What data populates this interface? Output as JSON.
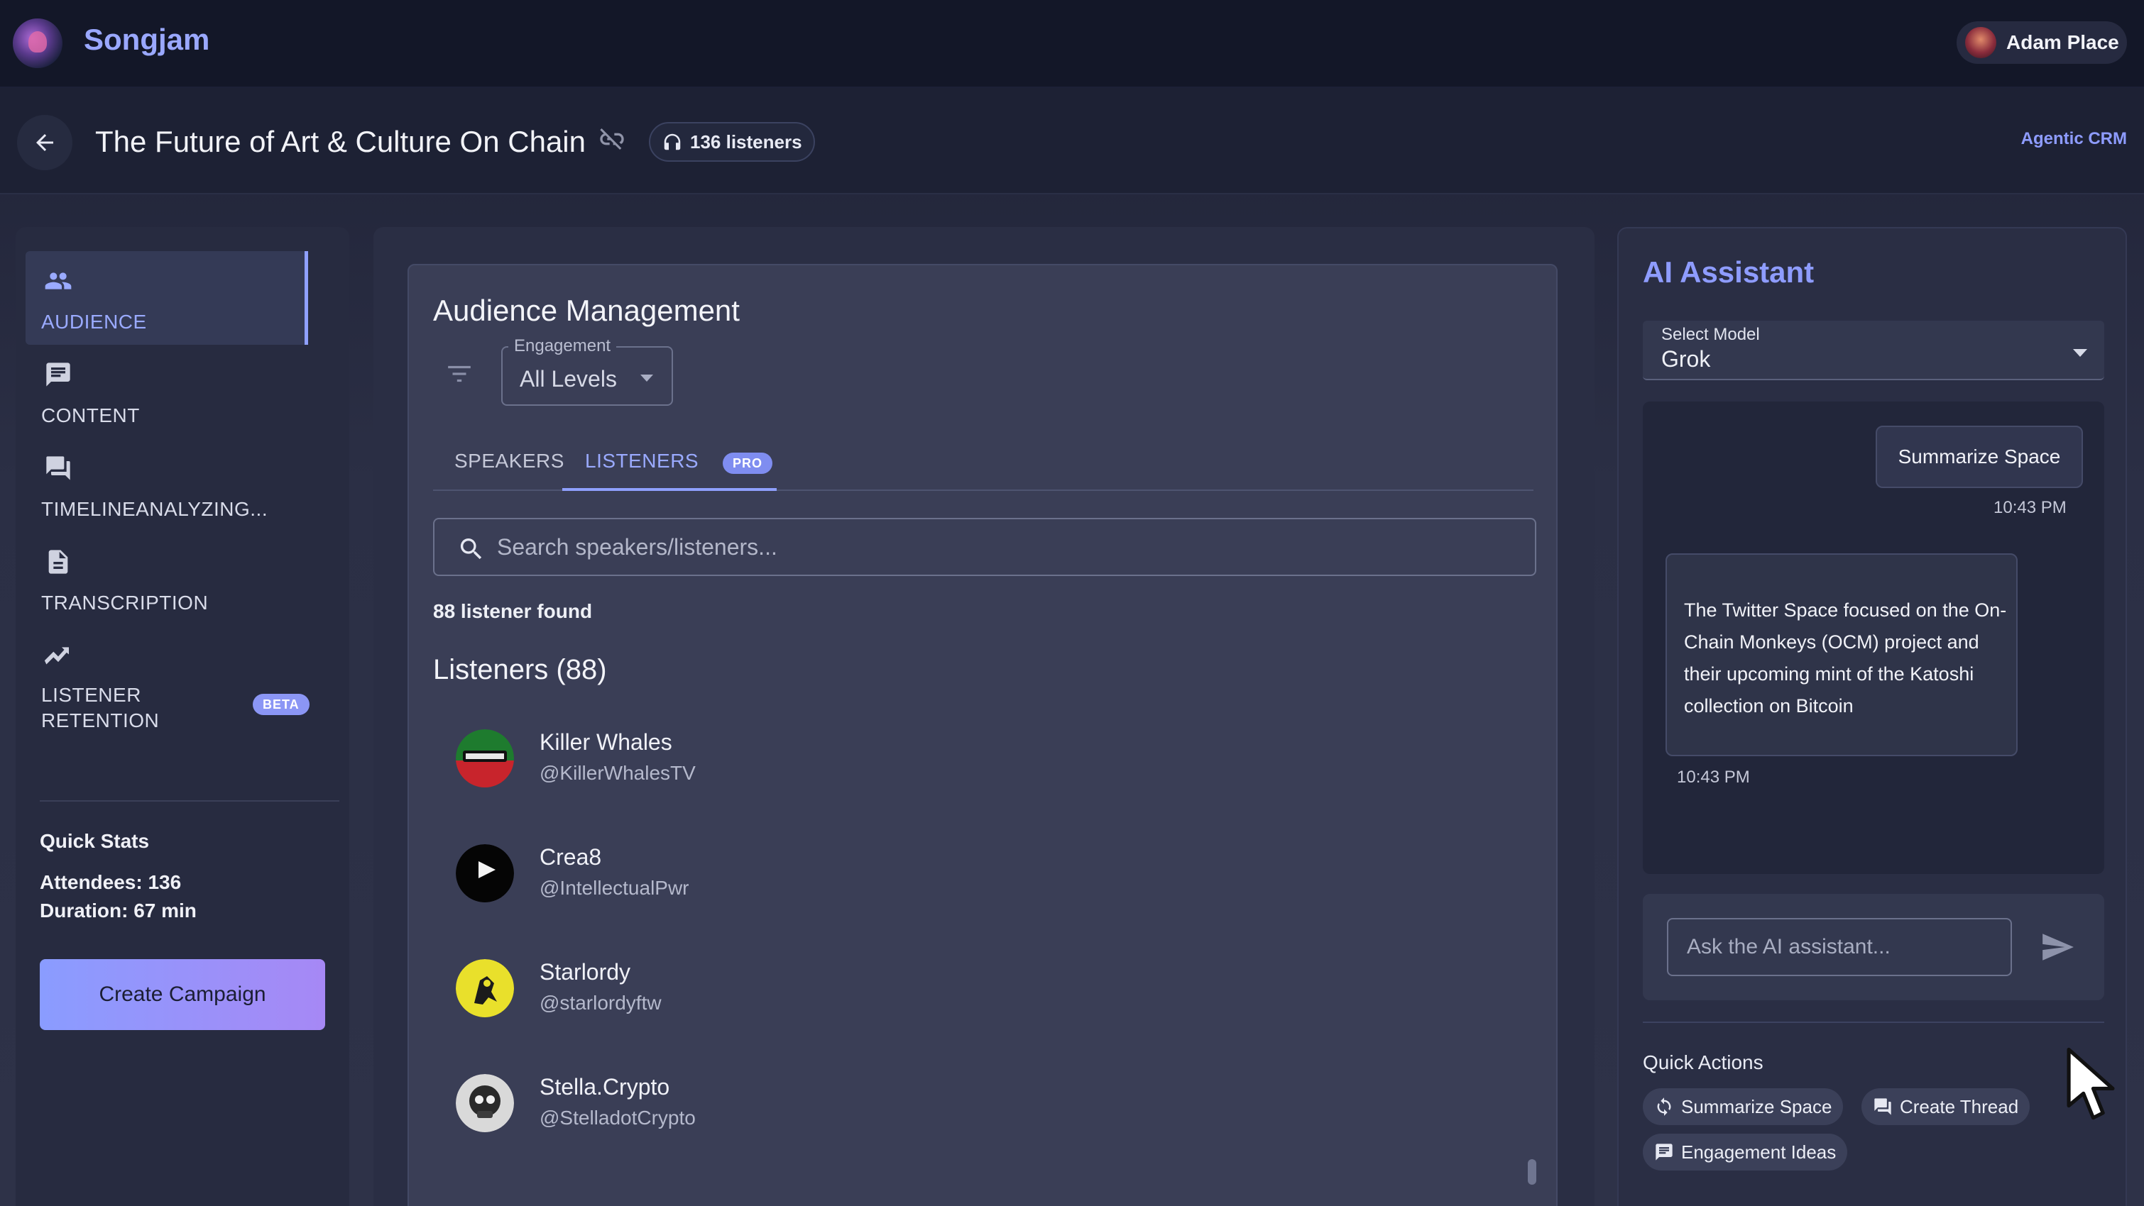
{
  "app": {
    "name": "Songjam"
  },
  "user": {
    "name": "Adam Place"
  },
  "header": {
    "title": "The Future of Art & Culture On Chain",
    "listeners_chip": "136 listeners",
    "agentic_link": "Agentic CRM"
  },
  "sidebar": {
    "items": [
      {
        "label": "AUDIENCE",
        "icon": "people-icon",
        "active": true
      },
      {
        "label": "CONTENT",
        "icon": "chat-bubble-icon"
      },
      {
        "label": "TIMELINEANALYZING...",
        "icon": "forum-icon"
      },
      {
        "label": "TRANSCRIPTION",
        "icon": "document-icon"
      },
      {
        "label_line1": "LISTENER",
        "label_line2": "RETENTION",
        "icon": "trending-icon",
        "badge": "BETA"
      }
    ],
    "quick_stats": {
      "title": "Quick Stats",
      "attendees": "Attendees: 136",
      "duration": "Duration: 67 min"
    },
    "create_campaign": "Create Campaign"
  },
  "audience": {
    "title": "Audience Management",
    "filter": {
      "label": "Engagement",
      "value": "All Levels"
    },
    "tabs": [
      {
        "label": "SPEAKERS"
      },
      {
        "label": "LISTENERS",
        "badge": "PRO",
        "active": true
      }
    ],
    "search_placeholder": "Search speakers/listeners...",
    "found_text": "88 listener found",
    "list_heading": "Listeners (88)",
    "listeners": [
      {
        "name": "Killer Whales",
        "handle": "@KillerWhalesTV"
      },
      {
        "name": "Crea8",
        "handle": "@IntellectualPwr"
      },
      {
        "name": "Starlordy",
        "handle": "@starlordyftw"
      },
      {
        "name": "Stella.Crypto",
        "handle": "@StelladotCrypto"
      }
    ]
  },
  "ai_assistant": {
    "title": "AI Assistant",
    "model_label": "Select Model",
    "model_value": "Grok",
    "messages": [
      {
        "role": "user",
        "text": "Summarize Space",
        "time": "10:43 PM"
      },
      {
        "role": "assistant",
        "text": "The Twitter Space focused on the On-Chain Monkeys (OCM) project and their upcoming mint of the Katoshi collection on Bitcoin",
        "time": "10:43 PM"
      }
    ],
    "input_placeholder": "Ask the AI assistant...",
    "quick_actions_title": "Quick Actions",
    "quick_actions": [
      {
        "label": "Summarize Space",
        "icon": "refresh-icon"
      },
      {
        "label": "Create Thread",
        "icon": "thread-icon"
      },
      {
        "label": "Engagement Ideas",
        "icon": "comment-icon"
      }
    ]
  },
  "colors": {
    "accent": "#8e9cff",
    "background": "#262a3f",
    "topbar": "#131728"
  }
}
